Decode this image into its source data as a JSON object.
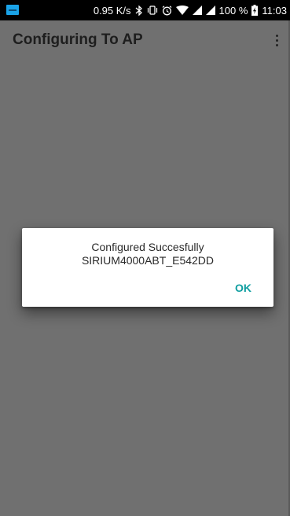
{
  "status_bar": {
    "speed": "0.95 K/s",
    "battery": "100 %",
    "time": "11:03",
    "icons": [
      "notification-app-icon",
      "bluetooth-icon",
      "vibrate-icon",
      "alarm-icon",
      "wifi-icon",
      "signal-icon",
      "signal-icon-2",
      "battery-charging-icon"
    ]
  },
  "app_bar": {
    "title": "Configuring To AP",
    "menu_icon": "overflow-menu-icon"
  },
  "dialog": {
    "line1": "Configured Succesfully",
    "line2": "SIRIUM4000ABT_E542DD",
    "ok_label": "OK"
  },
  "colors": {
    "background": "#707070",
    "status_bar": "#000000",
    "accent": "#0f9ea0",
    "dialog": "#ffffff"
  }
}
